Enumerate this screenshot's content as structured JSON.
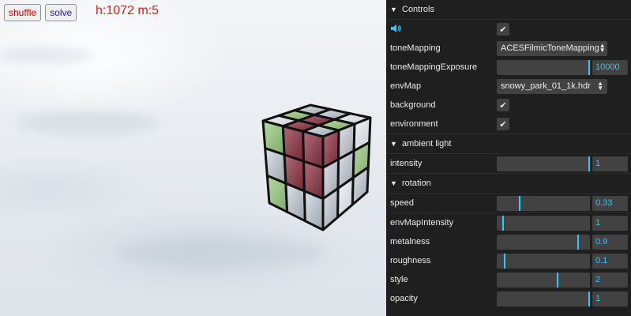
{
  "viewport": {
    "shuffle_label": "shuffle",
    "solve_label": "solve",
    "counter": "h:1072 m:5"
  },
  "controls": {
    "title": "Controls",
    "speaker_icon": "speaker-icon",
    "sound_checked": true,
    "toneMapping": {
      "label": "toneMapping",
      "value": "ACESFilmicToneMapping"
    },
    "toneMappingExposure": {
      "label": "toneMappingExposure",
      "value": "10000",
      "fraction": 1.0
    },
    "envMap": {
      "label": "envMap",
      "value": "snowy_park_01_1k.hdr"
    },
    "background": {
      "label": "background",
      "checked": true
    },
    "environment": {
      "label": "environment",
      "checked": true
    }
  },
  "ambient": {
    "title": "ambient light",
    "intensity": {
      "label": "intensity",
      "value": "1",
      "fraction": 1.0
    }
  },
  "rotation": {
    "title": "rotation",
    "speed": {
      "label": "speed",
      "value": "0.33",
      "fraction": 0.25
    }
  },
  "material": {
    "envMapIntensity": {
      "label": "envMapIntensity",
      "value": "1",
      "fraction": 0.08
    },
    "metalness": {
      "label": "metalness",
      "value": "0.9",
      "fraction": 0.88
    },
    "roughness": {
      "label": "roughness",
      "value": "0.1",
      "fraction": 0.09
    },
    "style": {
      "label": "style",
      "value": "2",
      "fraction": 0.66
    },
    "opacity": {
      "label": "opacity",
      "value": "1",
      "fraction": 1.0
    }
  },
  "colors": {
    "accent": "#2cc9ff",
    "panel_bg": "#1f1f1f",
    "widget_bg": "#424242"
  }
}
